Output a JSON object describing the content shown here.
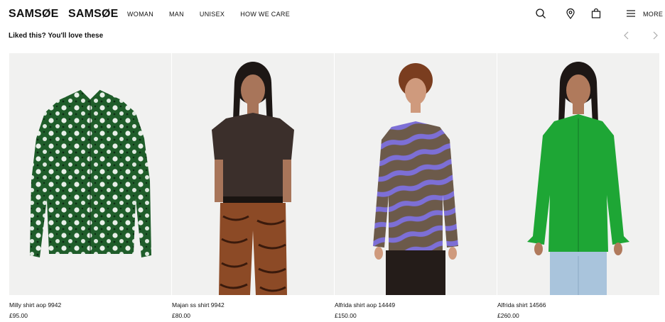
{
  "header": {
    "logo_primary": "SAMSØE",
    "logo_secondary": "SAMSØE",
    "nav": [
      "WOMAN",
      "MAN",
      "UNISEX",
      "HOW WE CARE"
    ],
    "icons": [
      "search-icon",
      "location-pin-icon",
      "bag-icon",
      "menu-icon"
    ],
    "more_label": "MORE"
  },
  "recommendations": {
    "title": "Liked this? You'll love these",
    "prev_icon": "chevron-left-icon",
    "next_icon": "chevron-right-icon",
    "products": [
      {
        "name": "Milly shirt aop 9942",
        "price": "£95.00"
      },
      {
        "name": "Majan ss shirt 9942",
        "price": "£80.00"
      },
      {
        "name": "Alfrida shirt aop 14449",
        "price": "£150.00"
      },
      {
        "name": "Alfrida shirt 14566",
        "price": "£260.00"
      }
    ]
  },
  "colors": {
    "image_bg": "#f1f1f0",
    "shirt_floral": "#1f5d2a",
    "shirt_brown": "#3b2f2b",
    "shirt_stripe": "#7d6fd6",
    "shirt_green": "#1ea635"
  }
}
